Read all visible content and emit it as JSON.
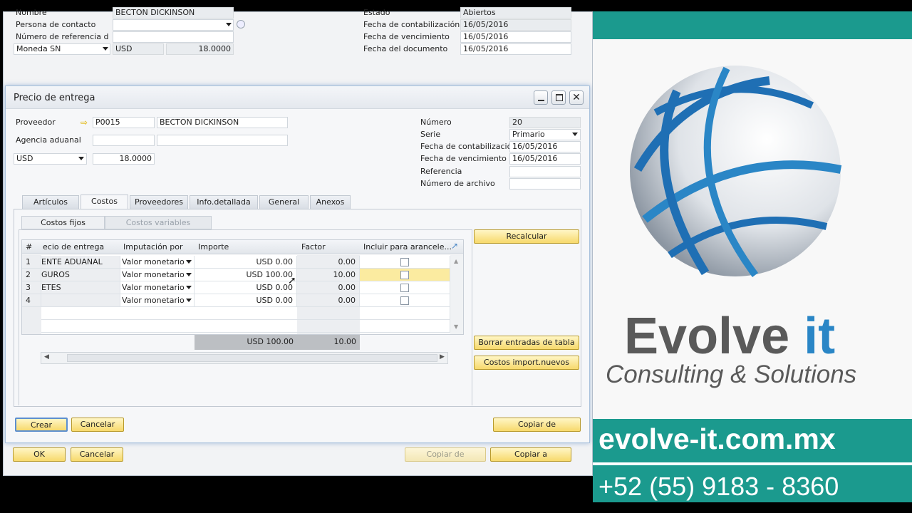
{
  "background_window": {
    "fields": [
      {
        "label": "Nombre",
        "value": "BECTON DICKINSON"
      },
      {
        "label": "Persona de contacto",
        "value": ""
      },
      {
        "label": "Número de referencia d",
        "value": ""
      },
      {
        "label": "Moneda SN",
        "value": "USD",
        "rate": "18.0000"
      }
    ],
    "right_fields": [
      {
        "label": "Estado",
        "value": "Abiertos"
      },
      {
        "label": "Fecha de contabilización",
        "value": "16/05/2016"
      },
      {
        "label": "Fecha de vencimiento",
        "value": "16/05/2016"
      },
      {
        "label": "Fecha del documento",
        "value": "16/05/2016"
      }
    ],
    "buttons": {
      "ok": "OK",
      "cancel": "Cancelar",
      "copy_from": "Copiar de",
      "copy_to": "Copiar a"
    }
  },
  "dialog": {
    "title": "Precio de entrega",
    "supplier_label": "Proveedor",
    "supplier_code": "P0015",
    "supplier_name": "BECTON DICKINSON",
    "customs_label": "Agencia aduanal",
    "currency": "USD",
    "rate": "18.0000",
    "right_fields": [
      {
        "label": "Número",
        "value": "20"
      },
      {
        "label": "Serie",
        "value": "Primario"
      },
      {
        "label": "Fecha de contabilización",
        "value": "16/05/2016"
      },
      {
        "label": "Fecha de vencimiento",
        "value": "16/05/2016"
      },
      {
        "label": "Referencia",
        "value": ""
      },
      {
        "label": "Número de archivo",
        "value": ""
      }
    ],
    "tabs": [
      "Artículos",
      "Costos",
      "Proveedores",
      "Info.detallada",
      "General",
      "Anexos"
    ],
    "subtabs": [
      "Costos fijos",
      "Costos variables"
    ],
    "columns": [
      "#",
      "ecio de entrega",
      "Imputación por",
      "Importe",
      "Factor",
      "Incluir para arancele..."
    ],
    "rows": [
      {
        "num": "1",
        "name": "ENTE ADUANAL",
        "imput": "Valor monetario",
        "amount": "USD 0.00",
        "factor": "0.00"
      },
      {
        "num": "2",
        "name": "GUROS",
        "imput": "Valor monetario",
        "amount": "USD 100.00",
        "factor": "10.00"
      },
      {
        "num": "3",
        "name": "ETES",
        "imput": "Valor monetario",
        "amount": "USD 0.00",
        "factor": "0.00"
      },
      {
        "num": "4",
        "name": "",
        "imput": "Valor monetario",
        "amount": "USD 0.00",
        "factor": "0.00"
      }
    ],
    "totals": {
      "amount": "USD 100.00",
      "factor": "10.00"
    },
    "side_buttons": {
      "recalc": "Recalcular",
      "clear": "Borrar entradas de tabla",
      "import": "Costos import.nuevos"
    },
    "bottom_buttons": {
      "create": "Crear",
      "cancel": "Cancelar",
      "copy_from": "Copiar de"
    }
  },
  "ad": {
    "brand": "Evolve",
    "brand_accent": "it",
    "tagline": "Consulting & Solutions",
    "website": "evolve-it.com.mx",
    "phone": "+52 (55) 9183 - 8360",
    "colors": {
      "teal": "#1b9a8e",
      "gray": "#5a5a5a",
      "blue": "#2a86c6"
    }
  }
}
